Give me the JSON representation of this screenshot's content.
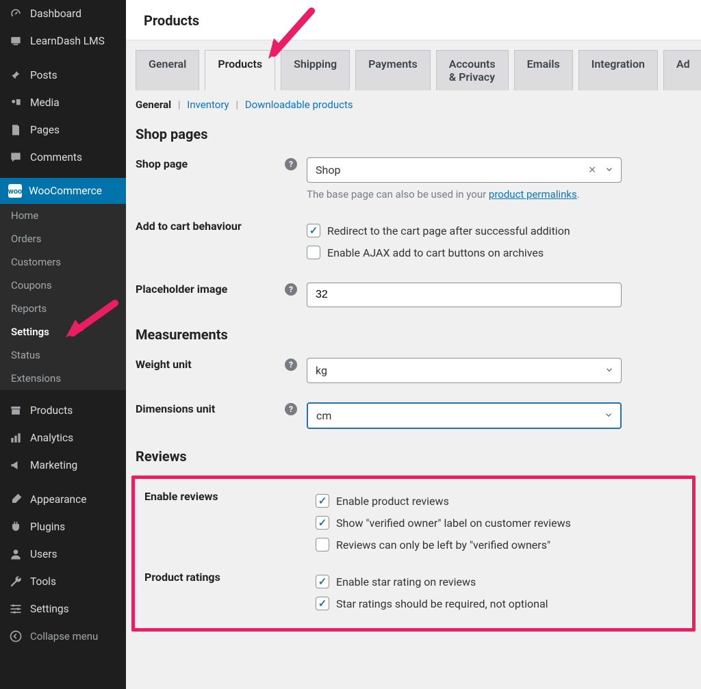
{
  "sidebar": {
    "items": [
      {
        "label": "Dashboard"
      },
      {
        "label": "LearnDash LMS"
      },
      {
        "label": "Posts"
      },
      {
        "label": "Media"
      },
      {
        "label": "Pages"
      },
      {
        "label": "Comments"
      },
      {
        "label": "WooCommerce"
      },
      {
        "label": "Products"
      },
      {
        "label": "Analytics"
      },
      {
        "label": "Marketing"
      },
      {
        "label": "Appearance"
      },
      {
        "label": "Plugins"
      },
      {
        "label": "Users"
      },
      {
        "label": "Tools"
      },
      {
        "label": "Settings"
      },
      {
        "label": "Collapse menu"
      }
    ],
    "wc_sub": [
      {
        "label": "Home"
      },
      {
        "label": "Orders"
      },
      {
        "label": "Customers"
      },
      {
        "label": "Coupons"
      },
      {
        "label": "Reports"
      },
      {
        "label": "Settings"
      },
      {
        "label": "Status"
      },
      {
        "label": "Extensions"
      }
    ]
  },
  "page": {
    "title": "Products"
  },
  "tabs": [
    {
      "label": "General"
    },
    {
      "label": "Products"
    },
    {
      "label": "Shipping"
    },
    {
      "label": "Payments"
    },
    {
      "label": "Accounts & Privacy"
    },
    {
      "label": "Emails"
    },
    {
      "label": "Integration"
    },
    {
      "label": "Ad"
    }
  ],
  "subtabs": {
    "general": "General",
    "inventory": "Inventory",
    "downloadable": "Downloadable products"
  },
  "sections": {
    "shop": "Shop pages",
    "measurements": "Measurements",
    "reviews": "Reviews"
  },
  "shop_page": {
    "label": "Shop page",
    "value": "Shop",
    "hint_pre": "The base page can also be used in your ",
    "hint_link": "product permalinks",
    "hint_post": "."
  },
  "cart": {
    "label": "Add to cart behaviour",
    "opt1": "Redirect to the cart page after successful addition",
    "opt2": "Enable AJAX add to cart buttons on archives"
  },
  "placeholder": {
    "label": "Placeholder image",
    "value": "32"
  },
  "weight": {
    "label": "Weight unit",
    "value": "kg"
  },
  "dims": {
    "label": "Dimensions unit",
    "value": "cm"
  },
  "reviews": {
    "enable_label": "Enable reviews",
    "o1": "Enable product reviews",
    "o2": "Show \"verified owner\" label on customer reviews",
    "o3": "Reviews can only be left by \"verified owners\"",
    "ratings_label": "Product ratings",
    "r1": "Enable star rating on reviews",
    "r2": "Star ratings should be required, not optional"
  }
}
